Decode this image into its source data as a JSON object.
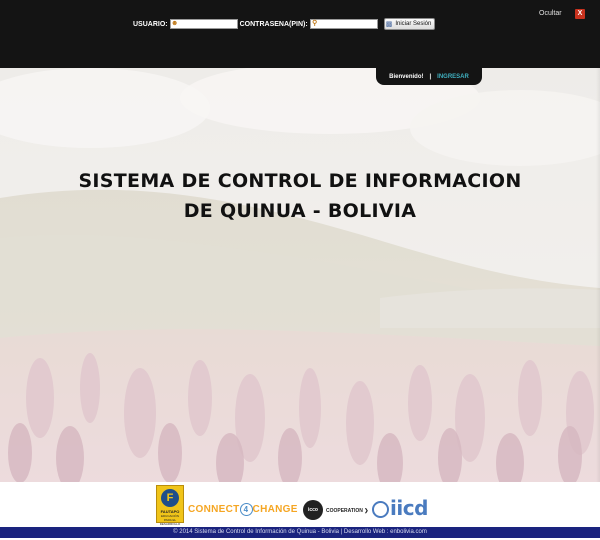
{
  "login": {
    "user_label": "USUARIO:",
    "user_value": "",
    "pin_label": "CONTRASENA(PIN):",
    "pin_value": "",
    "submit_label": "Iniciar Sesión",
    "user_icon": "user-icon",
    "key_icon": "key-icon",
    "submit_icon": "login-icon"
  },
  "panel": {
    "hide_label": "Ocultar",
    "close_label": "X"
  },
  "tab": {
    "welcome": "Bienvenido!",
    "separator": "|",
    "enter": "INGRESAR"
  },
  "hero": {
    "title_line1": "SISTEMA DE CONTROL DE INFORMACION",
    "title_line2": "DE QUINUA - BOLIVIA"
  },
  "logos": {
    "fautapo_name": "FAUTAPO",
    "fautapo_tagline": "EDUCACIÓN PARA EL DESARROLLO",
    "fautapo_mark": "F",
    "connect_pre": "CONNECT",
    "connect_num": "4",
    "connect_post": "CHANGE",
    "icco_mark": "icco",
    "icco_text": "COOPERATION ❯",
    "iicd_text": "iicd"
  },
  "footer": {
    "text": "© 2014 Sistema de Control de Información de Quinua - Bolivia | Desarrollo Web : enbolivia.com"
  },
  "colors": {
    "panel_bg": "#141414",
    "footer_bg": "#1a237e",
    "accent": "#3fb0c0",
    "close_red": "#c8321e"
  }
}
